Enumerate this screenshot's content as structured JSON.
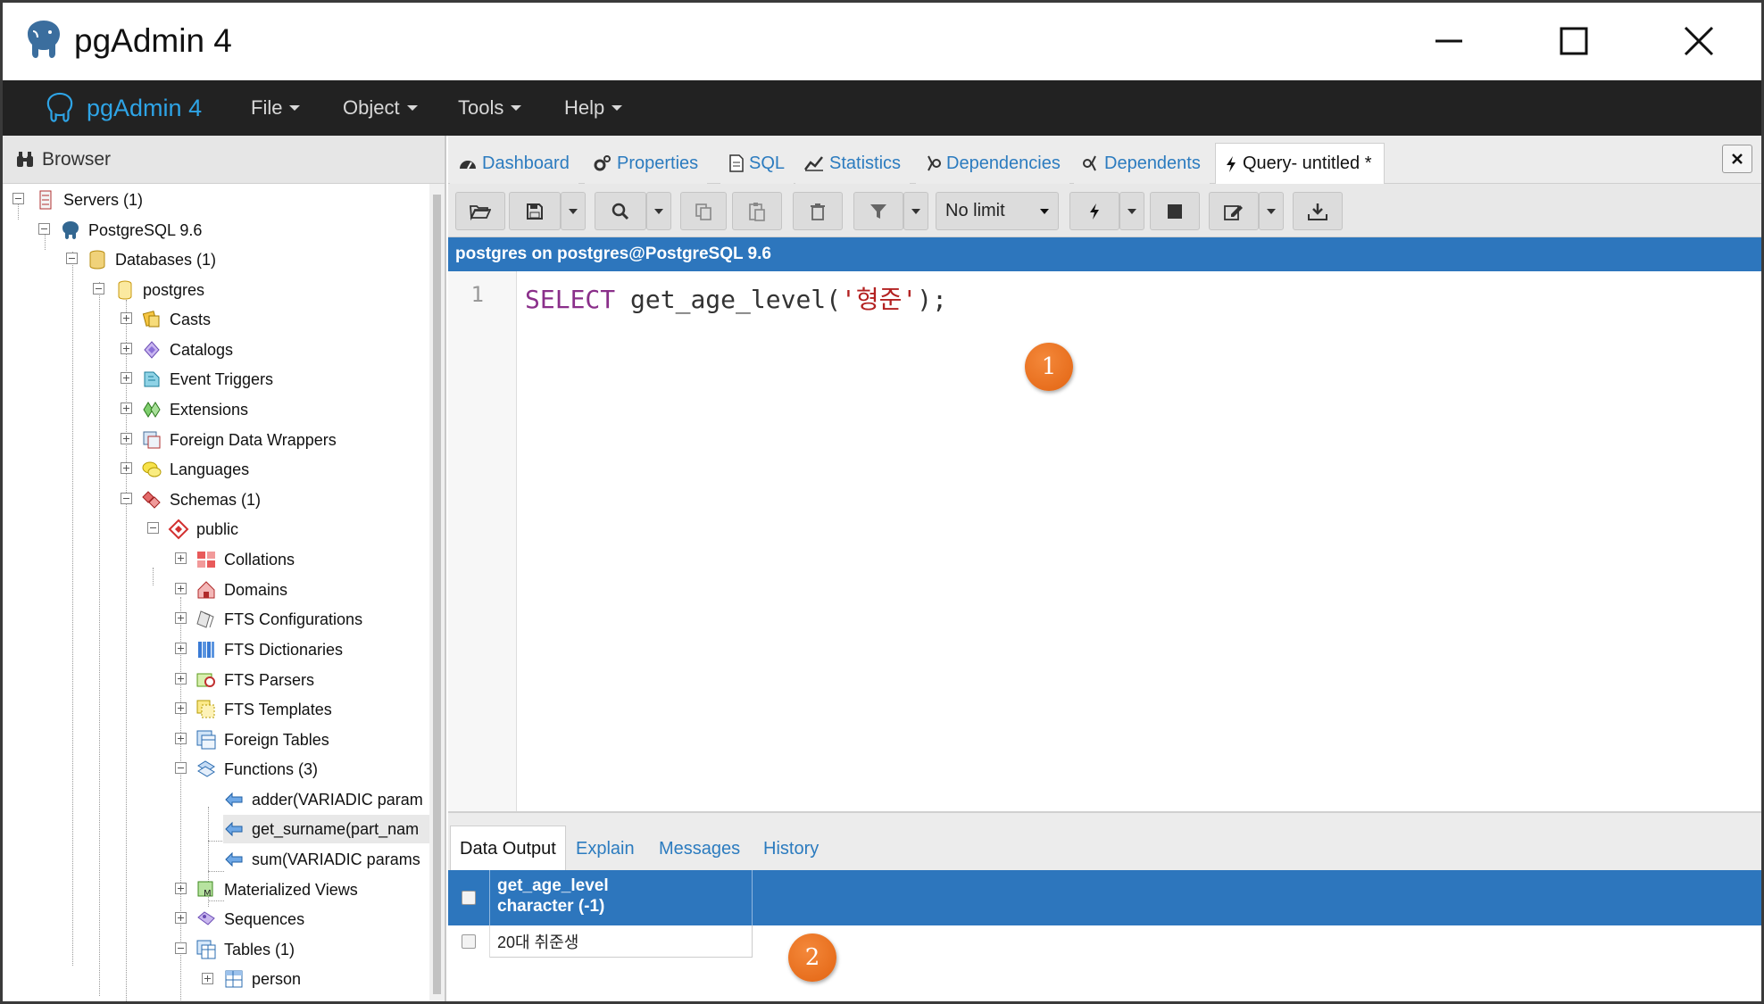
{
  "window": {
    "title": "pgAdmin 4",
    "controls": {
      "minimize": "minimize",
      "maximize": "maximize",
      "close": "close"
    }
  },
  "navbar": {
    "brand": "pgAdmin 4",
    "menus": [
      "File",
      "Object",
      "Tools",
      "Help"
    ]
  },
  "browser": {
    "title": "Browser",
    "tree": [
      {
        "label": "Servers (1)",
        "icon": "servers-icon"
      },
      {
        "label": "PostgreSQL 9.6",
        "icon": "elephant-icon"
      },
      {
        "label": "Databases (1)",
        "icon": "databases-icon"
      },
      {
        "label": "postgres",
        "icon": "database-icon"
      },
      {
        "label": "Casts",
        "icon": "casts-icon"
      },
      {
        "label": "Catalogs",
        "icon": "catalogs-icon"
      },
      {
        "label": "Event Triggers",
        "icon": "event-triggers-icon"
      },
      {
        "label": "Extensions",
        "icon": "extensions-icon"
      },
      {
        "label": "Foreign Data Wrappers",
        "icon": "fdw-icon"
      },
      {
        "label": "Languages",
        "icon": "languages-icon"
      },
      {
        "label": "Schemas (1)",
        "icon": "schemas-icon"
      },
      {
        "label": "public",
        "icon": "schema-icon"
      },
      {
        "label": "Collations",
        "icon": "collations-icon"
      },
      {
        "label": "Domains",
        "icon": "domains-icon"
      },
      {
        "label": "FTS Configurations",
        "icon": "fts-config-icon"
      },
      {
        "label": "FTS Dictionaries",
        "icon": "fts-dict-icon"
      },
      {
        "label": "FTS Parsers",
        "icon": "fts-parser-icon"
      },
      {
        "label": "FTS Templates",
        "icon": "fts-template-icon"
      },
      {
        "label": "Foreign Tables",
        "icon": "foreign-table-icon"
      },
      {
        "label": "Functions (3)",
        "icon": "functions-icon"
      },
      {
        "label": "adder(VARIADIC param",
        "icon": "function-icon"
      },
      {
        "label": "get_surname(part_nam",
        "icon": "function-icon"
      },
      {
        "label": "sum(VARIADIC params",
        "icon": "function-icon"
      },
      {
        "label": "Materialized Views",
        "icon": "matview-icon"
      },
      {
        "label": "Sequences",
        "icon": "sequences-icon"
      },
      {
        "label": "Tables (1)",
        "icon": "tables-icon"
      },
      {
        "label": "person",
        "icon": "table-icon"
      }
    ]
  },
  "tabs": [
    {
      "label": "Dashboard",
      "icon": "dashboard-icon"
    },
    {
      "label": "Properties",
      "icon": "properties-icon"
    },
    {
      "label": "SQL",
      "icon": "sql-icon"
    },
    {
      "label": "Statistics",
      "icon": "statistics-icon"
    },
    {
      "label": "Dependencies",
      "icon": "dependencies-icon"
    },
    {
      "label": "Dependents",
      "icon": "dependents-icon"
    },
    {
      "label": "Query- untitled *",
      "icon": "query-icon"
    }
  ],
  "toolbar": {
    "limit_value": "No limit"
  },
  "connection": "postgres on postgres@PostgreSQL 9.6",
  "editor": {
    "line_number": "1",
    "keyword": "SELECT",
    "function_call": " get_age_level(",
    "string_literal": "'형준'",
    "tail": ");"
  },
  "markers": [
    "1",
    "2"
  ],
  "output": {
    "tabs": [
      "Data Output",
      "Explain",
      "Messages",
      "History"
    ],
    "column_name": "get_age_level",
    "column_type": "character (-1)",
    "rows": [
      "20대 취준생"
    ]
  },
  "colors": {
    "accent": "#2d76bd",
    "navbar": "#222222",
    "brand": "#2ea4e6",
    "marker": "#e26412"
  }
}
